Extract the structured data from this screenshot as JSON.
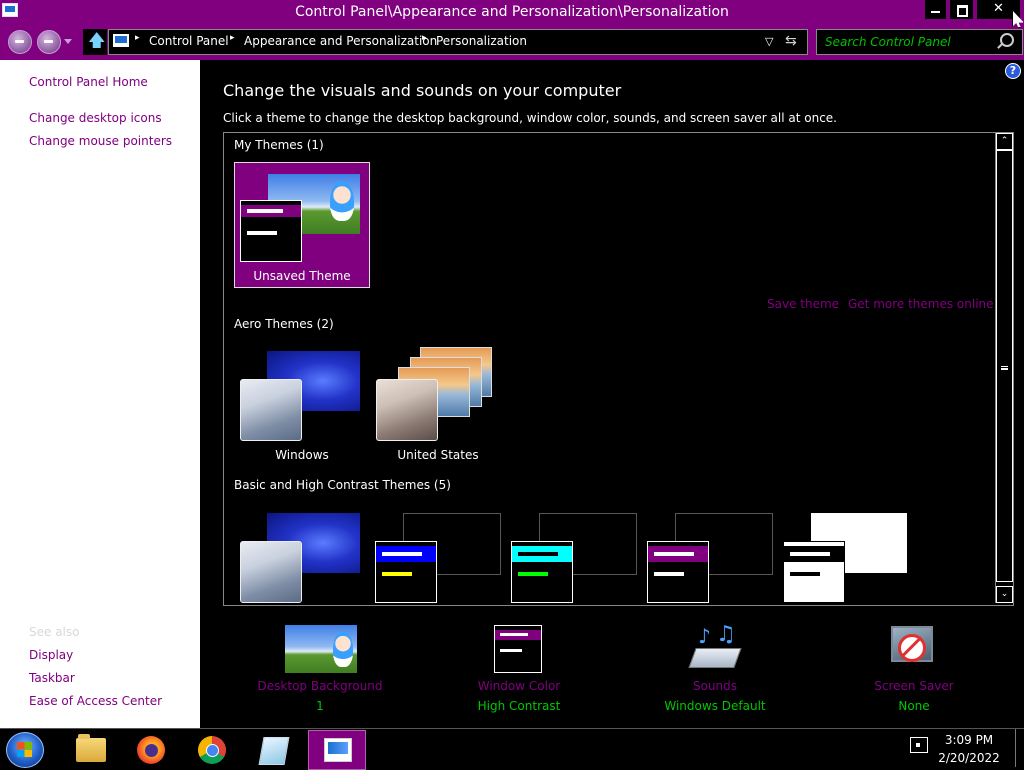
{
  "window": {
    "title": "Control Panel\\Appearance and Personalization\\Personalization",
    "close_glyph": "✕"
  },
  "address": {
    "crumbs": [
      "Control Panel",
      "Appearance and Personalization",
      "Personalization"
    ],
    "separator": "▸",
    "search_placeholder": "Search Control Panel"
  },
  "left_pane": {
    "home_link": "Control Panel Home",
    "links": [
      "Change desktop icons",
      "Change mouse pointers"
    ],
    "see_also_heading": "See also",
    "see_also": [
      "Display",
      "Taskbar",
      "Ease of Access Center"
    ]
  },
  "main": {
    "heading": "Change the visuals and sounds on your computer",
    "subheading": "Click a theme to change the desktop background, window color, sounds, and screen saver all at once.",
    "groups": {
      "my_themes": "My Themes (1)",
      "aero_themes": "Aero Themes (2)",
      "basic_themes": "Basic and High Contrast Themes (5)"
    },
    "themes": {
      "unsaved": "Unsaved Theme",
      "windows": "Windows",
      "united_states": "United States"
    },
    "actions": {
      "save_theme": "Save theme",
      "get_more": "Get more themes online"
    },
    "help_glyph": "?",
    "scroll_up_glyph": "⌃",
    "scroll_down_glyph": "⌄"
  },
  "customize": [
    {
      "label": "Desktop Background",
      "value": "1",
      "icon": "desktop-background-icon"
    },
    {
      "label": "Window Color",
      "value": "High Contrast",
      "icon": "window-color-icon"
    },
    {
      "label": "Sounds",
      "value": "Windows Default",
      "icon": "sounds-icon"
    },
    {
      "label": "Screen Saver",
      "value": "None",
      "icon": "screen-saver-icon"
    }
  ],
  "taskbar": {
    "time": "3:09 PM",
    "date": "2/20/2022"
  },
  "colors": {
    "accent": "#800080",
    "value_green": "#00c800",
    "background": "#000000",
    "left_pane": "#ffffff"
  }
}
